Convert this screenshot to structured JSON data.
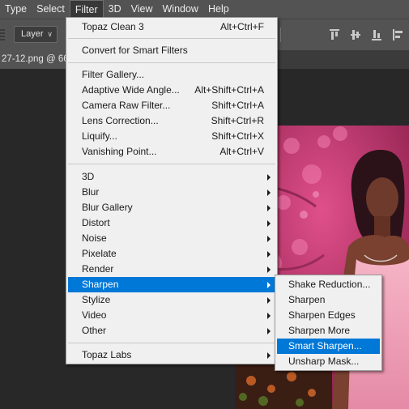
{
  "menubar": {
    "items": [
      {
        "label": "Type"
      },
      {
        "label": "Select"
      },
      {
        "label": "Filter"
      },
      {
        "label": "3D"
      },
      {
        "label": "View"
      },
      {
        "label": "Window"
      },
      {
        "label": "Help"
      }
    ]
  },
  "options_bar": {
    "layer_select_value": "Layer"
  },
  "document": {
    "tab_title": "27-12.png @ 66"
  },
  "filter_menu": {
    "items": [
      {
        "label": "Topaz Clean 3",
        "shortcut": "Alt+Ctrl+F"
      },
      {
        "label": "Convert for Smart Filters",
        "shortcut": ""
      },
      {
        "label": "Filter Gallery...",
        "shortcut": ""
      },
      {
        "label": "Adaptive Wide Angle...",
        "shortcut": "Alt+Shift+Ctrl+A"
      },
      {
        "label": "Camera Raw Filter...",
        "shortcut": "Shift+Ctrl+A"
      },
      {
        "label": "Lens Correction...",
        "shortcut": "Shift+Ctrl+R"
      },
      {
        "label": "Liquify...",
        "shortcut": "Shift+Ctrl+X"
      },
      {
        "label": "Vanishing Point...",
        "shortcut": "Alt+Ctrl+V"
      },
      {
        "label": "3D"
      },
      {
        "label": "Blur"
      },
      {
        "label": "Blur Gallery"
      },
      {
        "label": "Distort"
      },
      {
        "label": "Noise"
      },
      {
        "label": "Pixelate"
      },
      {
        "label": "Render"
      },
      {
        "label": "Sharpen"
      },
      {
        "label": "Stylize"
      },
      {
        "label": "Video"
      },
      {
        "label": "Other"
      },
      {
        "label": "Topaz Labs"
      }
    ]
  },
  "sharpen_submenu": {
    "items": [
      {
        "label": "Shake Reduction..."
      },
      {
        "label": "Sharpen"
      },
      {
        "label": "Sharpen Edges"
      },
      {
        "label": "Sharpen More"
      },
      {
        "label": "Smart Sharpen..."
      },
      {
        "label": "Unsharp Mask..."
      }
    ]
  },
  "colors": {
    "highlight": "#0078d7",
    "menu_bg": "#f0f0f0",
    "chrome": "#535353"
  }
}
